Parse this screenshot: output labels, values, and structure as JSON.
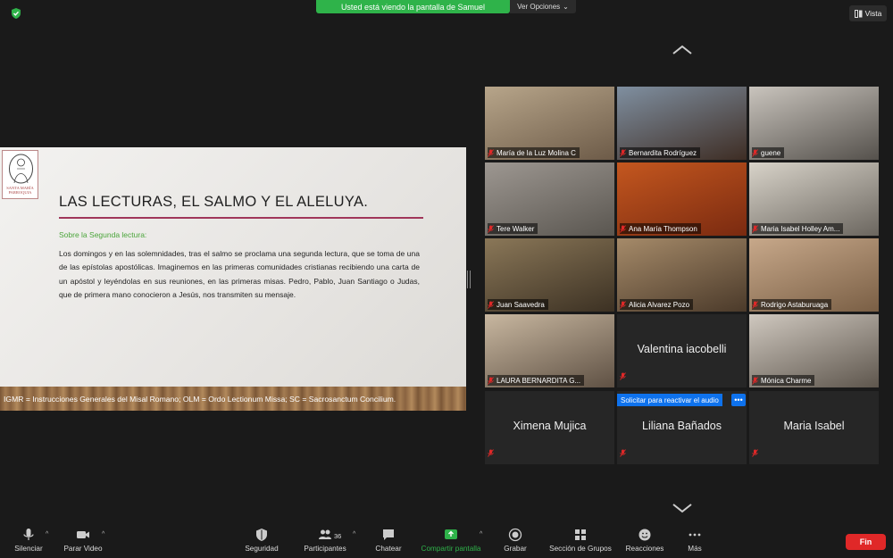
{
  "top": {
    "share_banner": "Usted está viendo la pantalla de Samuel",
    "options_label": "Ver Opciones",
    "view_label": "Vista"
  },
  "slide": {
    "logo_text_1": "SANTA MARÍA",
    "logo_text_2": "PARROQUIA",
    "title": "LAS LECTURAS, EL SALMO Y EL ALELUYA.",
    "subtitle": "Sobre la Segunda lectura:",
    "body": "Los domingos y en las solemnidades, tras el salmo se proclama una segunda lectura, que se toma de una de las epístolas apostólicas. Imaginemos en las primeras comunidades cristianas recibiendo una carta de un apóstol y leyéndolas en sus reuniones, en las primeras misas. Pedro, Pablo, Juan Santiago o Judas, que de primera mano conocieron a Jesús, nos transmiten su mensaje.",
    "footer": "IGMR = Instrucciones Generales del Misal Romano;  OLM = Ordo Lectionum Missa;  SC = Sacrosanctum Concilium."
  },
  "participants": [
    {
      "name": "María de la Luz Molina C",
      "video": true,
      "bg": "#b7a58a",
      "bg2": "#6d5b48"
    },
    {
      "name": "Bernardita Rodríguez",
      "video": true,
      "bg": "#7f8fa0",
      "bg2": "#3e2d24"
    },
    {
      "name": "guene",
      "video": true,
      "bg": "#c9c4bd",
      "bg2": "#55514c"
    },
    {
      "name": "Tere Walker",
      "video": true,
      "bg": "#9d9791",
      "bg2": "#5a5650"
    },
    {
      "name": "Ana María Thompson",
      "video": true,
      "bg": "#c4571f",
      "bg2": "#7a2a10"
    },
    {
      "name": "Maria Isabel Holley Am...",
      "video": true,
      "bg": "#d8d3c9",
      "bg2": "#6b665f"
    },
    {
      "name": "Juan Saavedra",
      "video": true,
      "bg": "#8a7758",
      "bg2": "#3c3123"
    },
    {
      "name": "Alicia Alvarez Pozo",
      "video": true,
      "bg": "#a58a69",
      "bg2": "#4b3a2a"
    },
    {
      "name": "Rodrigo Astaburuaga",
      "video": true,
      "bg": "#c7a88a",
      "bg2": "#7a5f45"
    },
    {
      "name": "LAURA BERNARDITA G...",
      "video": true,
      "bg": "#c8b7a0",
      "bg2": "#5f5144"
    },
    {
      "name": "Valentina iacobelli",
      "video": false
    },
    {
      "name": "Mónica Charme",
      "video": true,
      "bg": "#cfc8bf",
      "bg2": "#5e564d"
    },
    {
      "name": "Ximena Mujica",
      "video": false
    },
    {
      "name": "Liliana Bañados",
      "video": false,
      "reactivate": "Solicitar para reactivar el audio",
      "more": "•••"
    },
    {
      "name": "Maria Isabel",
      "video": false
    }
  ],
  "toolbar": {
    "mute": "Silenciar",
    "stop_video": "Parar Video",
    "security": "Seguridad",
    "participants": "Participantes",
    "participants_count": "36",
    "chat": "Chatear",
    "share_screen": "Compartir pantalla",
    "record": "Grabar",
    "breakout": "Sección de Grupos",
    "reactions": "Reacciones",
    "more": "Más",
    "end": "Fin"
  },
  "colors": {
    "share_green": "#2fb34a",
    "end_red": "#e02828",
    "reactivate_blue": "#0e72ed",
    "title_rule": "#a0365a"
  }
}
